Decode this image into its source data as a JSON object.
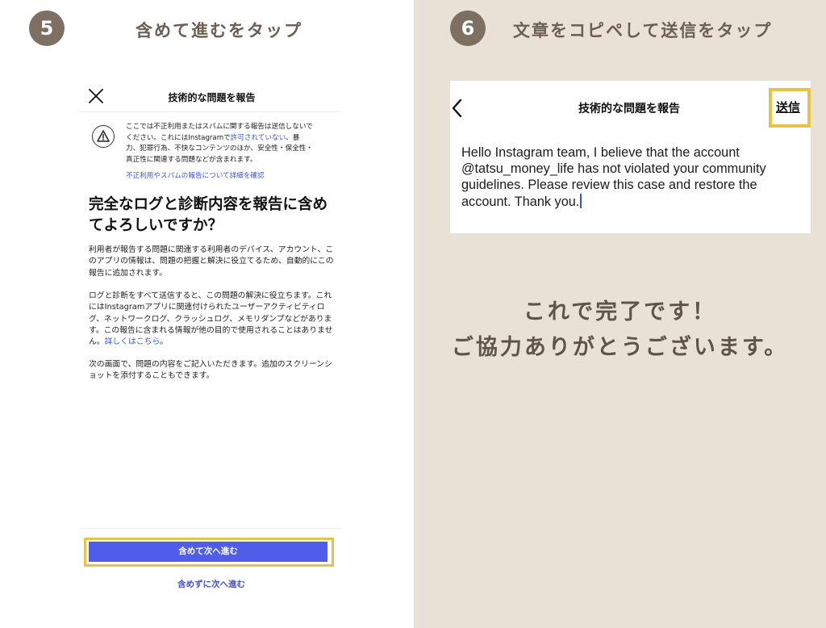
{
  "left": {
    "step_number": "5",
    "step_title": "含めて進むをタップ",
    "screen_title": "技術的な問題を報告",
    "close_icon": "close-icon",
    "warning_icon": "warning-triangle-icon",
    "warning_line1": "ここでは不正利用またはスパムに関する報告は送信しないで",
    "warning_line2_pre": "ください。これにはInstagramで",
    "warning_line2_link": "許可されていない",
    "warning_line2_post": "、暴",
    "warning_line3": "力、犯罪行為、不快なコンテンツのほか、安全性・保全性・",
    "warning_line4": "真正性に関連する問題などが含まれます。",
    "spam_link": "不正利用やスパムの報告について詳細を確認",
    "heading": "完全なログと診断内容を報告に含めてよろしいですか？",
    "para1": "利用者が報告する問題に関連する利用者のデバイス、アカウント、このアプリの情報は、問題の把握と解決に役立てるため、自動的にこの報告に追加されます。",
    "para2": "ログと診断をすべて送信すると、この問題の解決に役立ちます。これにはInstagramアプリに関連付けられたユーザーアクティビティログ、ネットワークログ、クラッシュログ、メモリダンプなどがあります。この報告に含まれる情報が他の目的で使用されることはありません。",
    "para2_link": "詳しくはこちら",
    "para2_end": "。",
    "para3": "次の画面で、問題の内容をご記入いただきます。追加のスクリーンショットを添付することもできます。",
    "primary_button": "含めて次へ進む",
    "secondary_button": "含めずに次へ進む"
  },
  "right": {
    "step_number": "6",
    "step_title": "文章をコピペして送信をタップ",
    "screen_title": "技術的な問題を報告",
    "back_icon": "back-arrow-icon",
    "send_button": "送信",
    "message_line1": "Hello Instagram team, I believe that the account",
    "message_line2": "@tatsu_money_life has not violated your community",
    "message_line3": "guidelines. Please review this case and restore the",
    "message_line4": "account. Thank you.",
    "done_line1": "これで完了です！",
    "done_line2": "ご協力ありがとうございます。"
  },
  "colors": {
    "step_circle": "#7d6f62",
    "right_background": "#e9e1d6",
    "highlight_box": "#e6c441",
    "primary_button": "#4f5dea",
    "link": "#3e55d8"
  }
}
